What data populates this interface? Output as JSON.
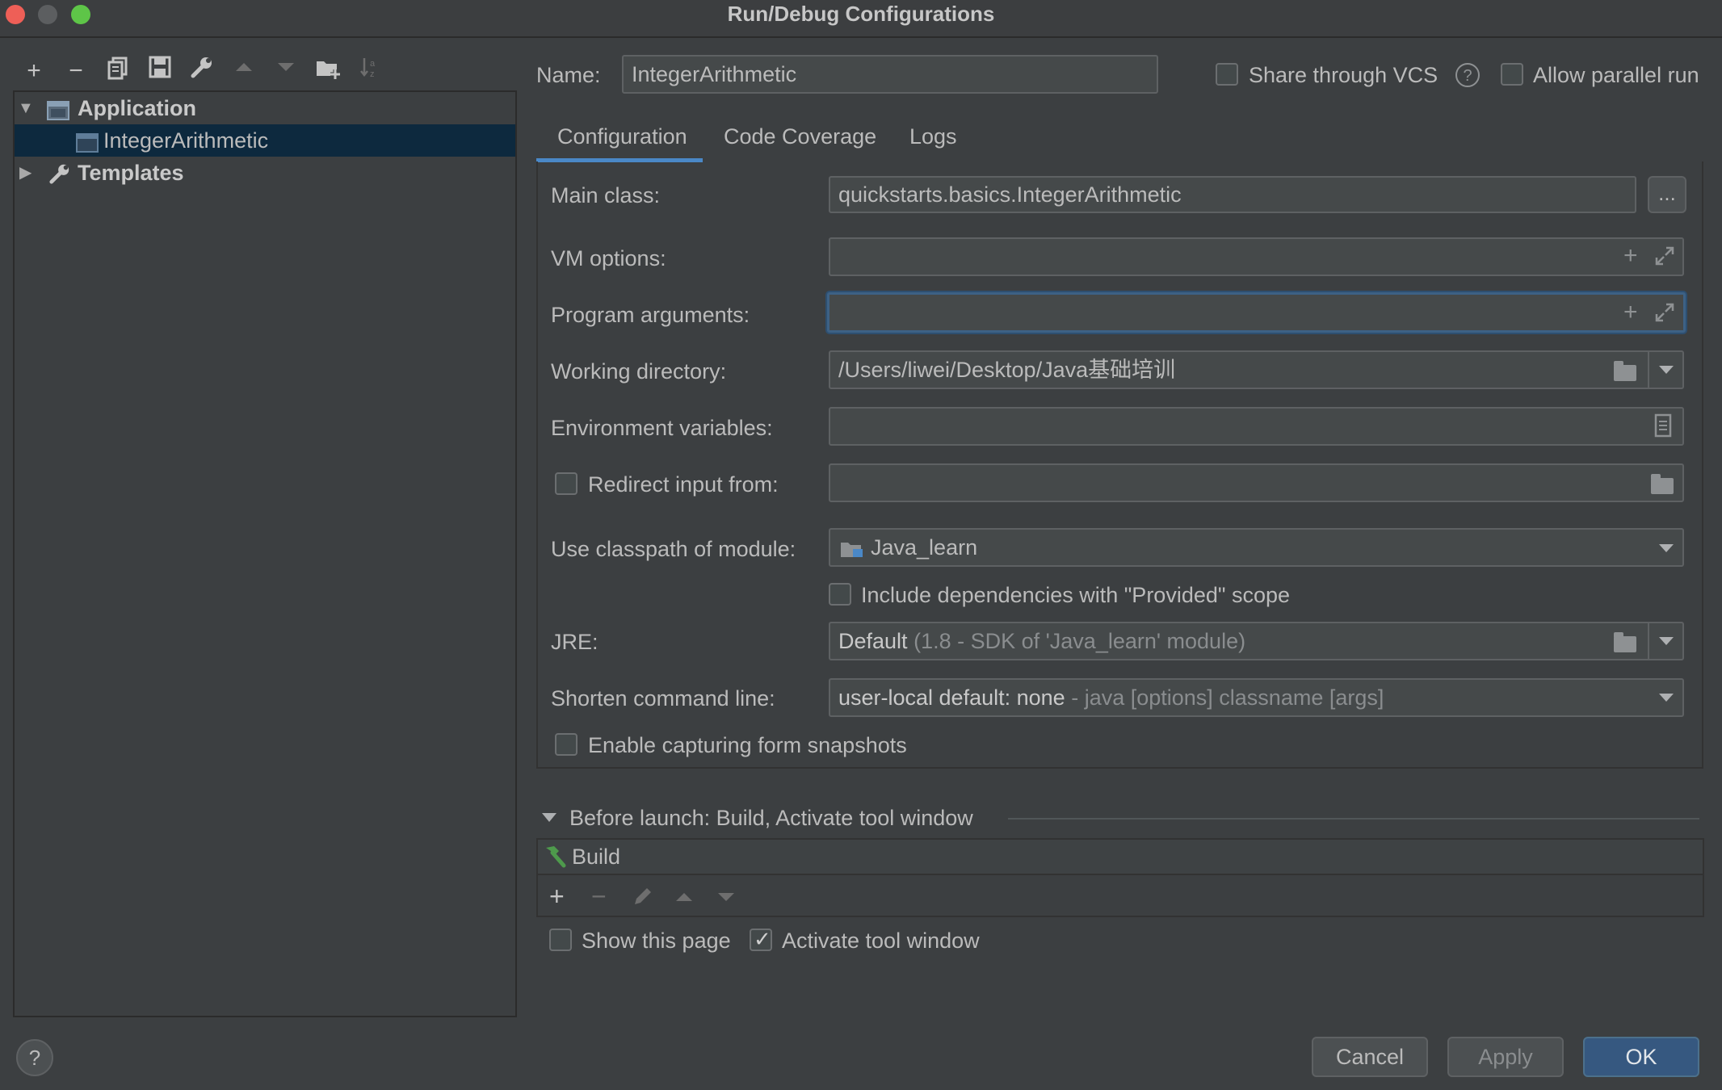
{
  "window": {
    "title": "Run/Debug Configurations"
  },
  "toolbar": {
    "icons": [
      "add-icon",
      "remove-icon",
      "copy-icon",
      "save-icon",
      "wrench-icon",
      "move-up-icon",
      "move-down-icon",
      "new-folder-icon",
      "sort-icon"
    ]
  },
  "tree": {
    "application_label": "Application",
    "config_label": "IntegerArithmetic",
    "templates_label": "Templates"
  },
  "header": {
    "name_label": "Name:",
    "name_value": "IntegerArithmetic",
    "share_vcs_label": "Share through VCS",
    "allow_parallel_label": "Allow parallel run"
  },
  "tabs": [
    {
      "label": "Configuration",
      "active": true
    },
    {
      "label": "Code Coverage",
      "active": false
    },
    {
      "label": "Logs",
      "active": false
    }
  ],
  "form": {
    "main_class_label": "Main class:",
    "main_class_value": "quickstarts.basics.IntegerArithmetic",
    "browse_label": "...",
    "vm_options_label": "VM options:",
    "vm_options_value": "",
    "program_args_label": "Program arguments:",
    "program_args_value": "",
    "working_dir_label": "Working directory:",
    "working_dir_value": "/Users/liwei/Desktop/Java基础培训",
    "env_vars_label": "Environment variables:",
    "env_vars_value": "",
    "redirect_label": "Redirect input from:",
    "redirect_value": "",
    "classpath_label": "Use classpath of module:",
    "classpath_value": "Java_learn",
    "include_deps_label": "Include dependencies with \"Provided\" scope",
    "jre_label": "JRE:",
    "jre_value": "Default",
    "jre_hint": "(1.8 - SDK of 'Java_learn' module)",
    "shorten_label": "Shorten command line:",
    "shorten_value": "user-local default: none",
    "shorten_hint": "- java [options] classname [args]",
    "snapshots_label": "Enable capturing form snapshots"
  },
  "before_launch": {
    "title": "Before launch: Build, Activate tool window",
    "item_label": "Build",
    "show_page_label": "Show this page",
    "activate_label": "Activate tool window"
  },
  "buttons": {
    "help_label": "?",
    "cancel_label": "Cancel",
    "apply_label": "Apply",
    "ok_label": "OK"
  },
  "colors": {
    "background": "#3c3f41",
    "field_bg": "#45494a",
    "selection": "#0d293e",
    "accent": "#4a88c7",
    "primary_button": "#365880",
    "build_icon": "#4e9a4c"
  }
}
